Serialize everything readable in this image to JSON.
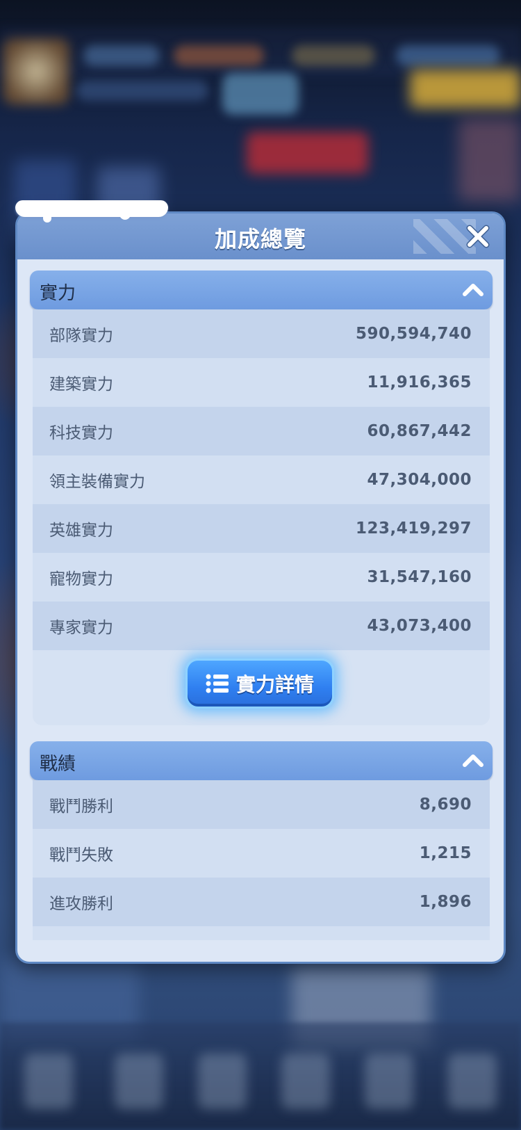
{
  "dialog": {
    "title": "加成總覽"
  },
  "power_section": {
    "header": "實力",
    "rows": [
      {
        "label": "部隊實力",
        "value": "590,594,740"
      },
      {
        "label": "建築實力",
        "value": "11,916,365"
      },
      {
        "label": "科技實力",
        "value": "60,867,442"
      },
      {
        "label": "領主裝備實力",
        "value": "47,304,000"
      },
      {
        "label": "英雄實力",
        "value": "123,419,297"
      },
      {
        "label": "寵物實力",
        "value": "31,547,160"
      },
      {
        "label": "專家實力",
        "value": "43,073,400"
      }
    ],
    "detail_button": "實力詳情"
  },
  "record_section": {
    "header": "戰績",
    "rows": [
      {
        "label": "戰鬥勝利",
        "value": "8,690"
      },
      {
        "label": "戰鬥失敗",
        "value": "1,215"
      },
      {
        "label": "進攻勝利",
        "value": "1,896"
      }
    ]
  },
  "icons": {
    "close": "close-icon",
    "collapse": "chevron-up-icon",
    "detail": "list-icon"
  },
  "colors": {
    "header": "#6a90cc",
    "section_header": "#6e9be0",
    "panel_bg": "#dde7f6",
    "button": "#2f7ff0"
  }
}
